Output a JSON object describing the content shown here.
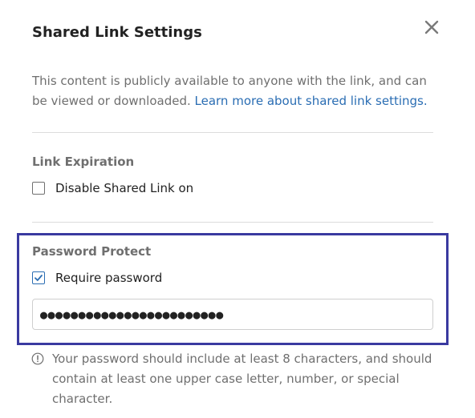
{
  "dialog": {
    "title": "Shared Link Settings",
    "close_icon": "close-icon",
    "description_text": "This content is publicly available to anyone with the link, and can be viewed or downloaded. ",
    "learn_more_link": "Learn more about shared link settings."
  },
  "link_expiration": {
    "label": "Link Expiration",
    "checkbox_label": "Disable Shared Link on",
    "checked": false
  },
  "password_protect": {
    "label": "Password Protect",
    "checkbox_label": "Require password",
    "checked": true,
    "password_value": "●●●●●●●●●●●●●●●●●●●●●●●●",
    "hint_icon": "info-alert-icon",
    "hint": "Your password should include at least 8 characters, and should contain at least one upper case letter, number, or special character."
  },
  "colors": {
    "accent": "#2a6db3",
    "highlight_border": "#3a3aa0",
    "text_primary": "#222222",
    "text_secondary": "#6f6f6f",
    "divider": "#dcdcdc"
  }
}
